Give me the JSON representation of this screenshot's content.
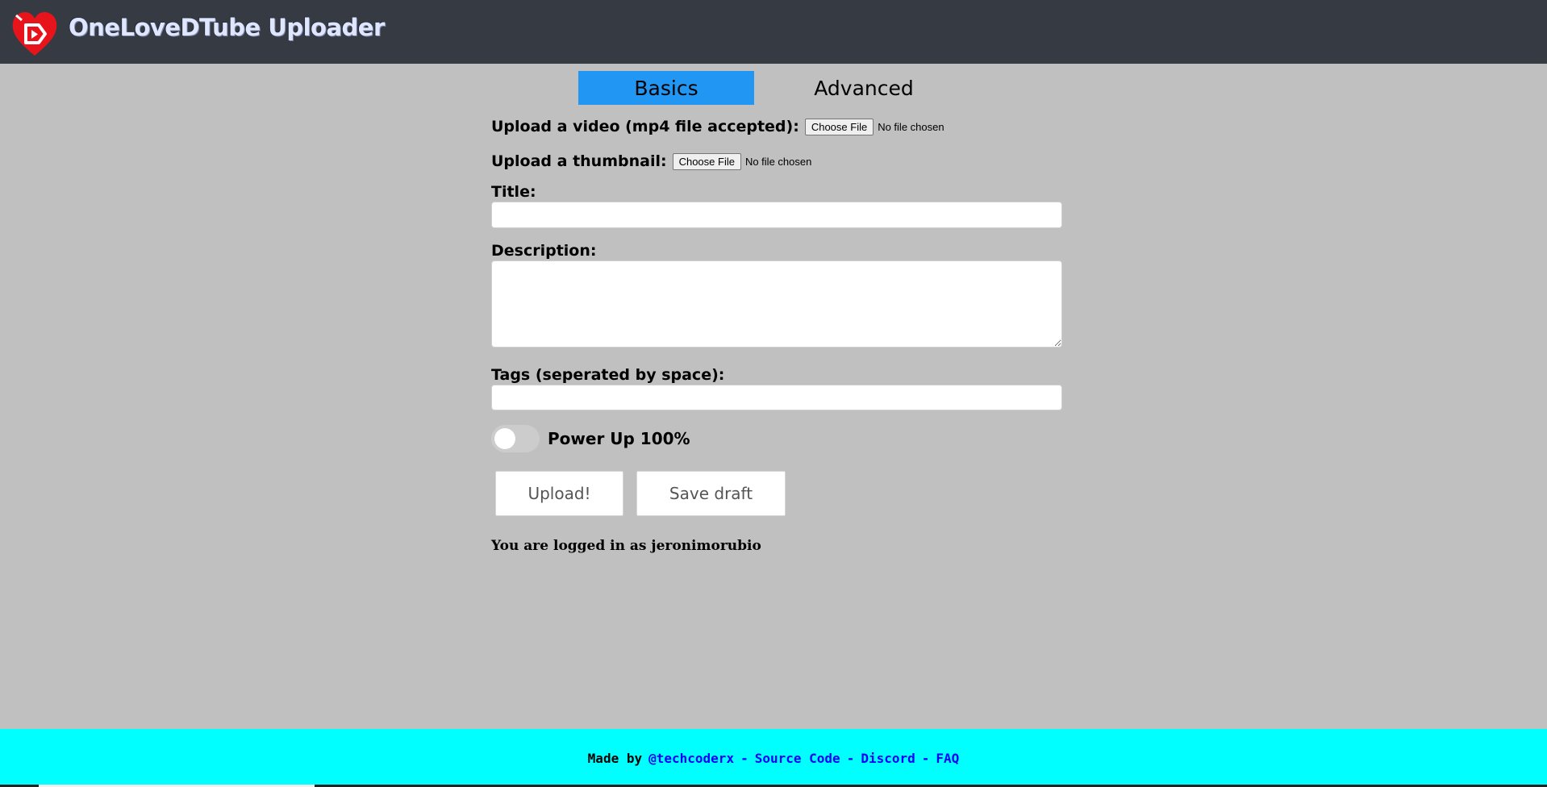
{
  "app": {
    "title": "OneLoveDTube Uploader",
    "logo_icon": "heart-play-logo-icon",
    "colors": {
      "navbar": "#363a43",
      "background": "#c0c0c0",
      "accent": "#2196f3",
      "footer": "#00ffff",
      "link": "#0000ff",
      "logo_red": "#e8141b"
    }
  },
  "tabs": [
    {
      "label": "Basics",
      "active": true
    },
    {
      "label": "Advanced",
      "active": false
    }
  ],
  "form": {
    "video": {
      "label": "Upload a video (mp4 file accepted):",
      "button": "Choose File",
      "status": "No file chosen"
    },
    "thumbnail": {
      "label": "Upload a thumbnail:",
      "button": "Choose File",
      "status": "No file chosen"
    },
    "title": {
      "label": "Title:",
      "value": ""
    },
    "description": {
      "label": "Description:",
      "value": ""
    },
    "tags": {
      "label": "Tags (seperated by space):",
      "value": ""
    },
    "powerup": {
      "label": "Power Up 100%",
      "on": false
    },
    "buttons": {
      "upload": "Upload!",
      "save_draft": "Save draft"
    },
    "login_status": "You are logged in as jeronimorubio"
  },
  "footer": {
    "made_by": "Made by",
    "separator": "-",
    "links": {
      "author": "@techcoderx",
      "source": "Source Code",
      "discord": "Discord",
      "faq": "FAQ"
    }
  }
}
